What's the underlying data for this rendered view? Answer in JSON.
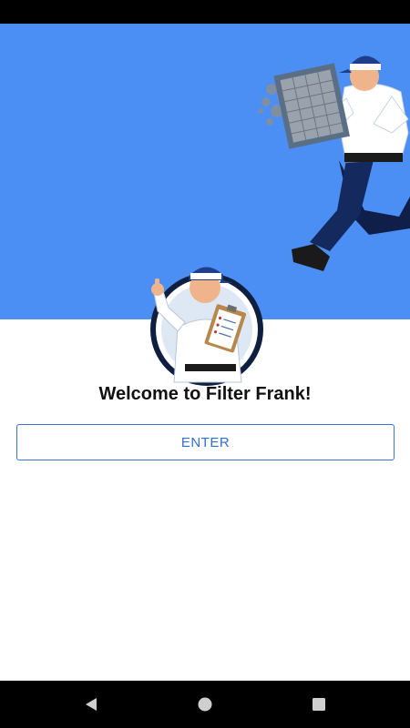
{
  "app": {
    "welcome_text": "Welcome to Filter Frank!",
    "enter_label": "ENTER"
  },
  "colors": {
    "hero_blue": "#4b8ef4",
    "button_text": "#2f6fd6",
    "button_border": "#3a73d9",
    "system_bars": "#000000"
  },
  "icons": {
    "hero_illustration": "running-technician-with-dirty-filter",
    "badge_illustration": "technician-with-clipboard-badge",
    "nav_back": "triangle-back",
    "nav_home": "circle-home",
    "nav_recents": "square-recents"
  }
}
